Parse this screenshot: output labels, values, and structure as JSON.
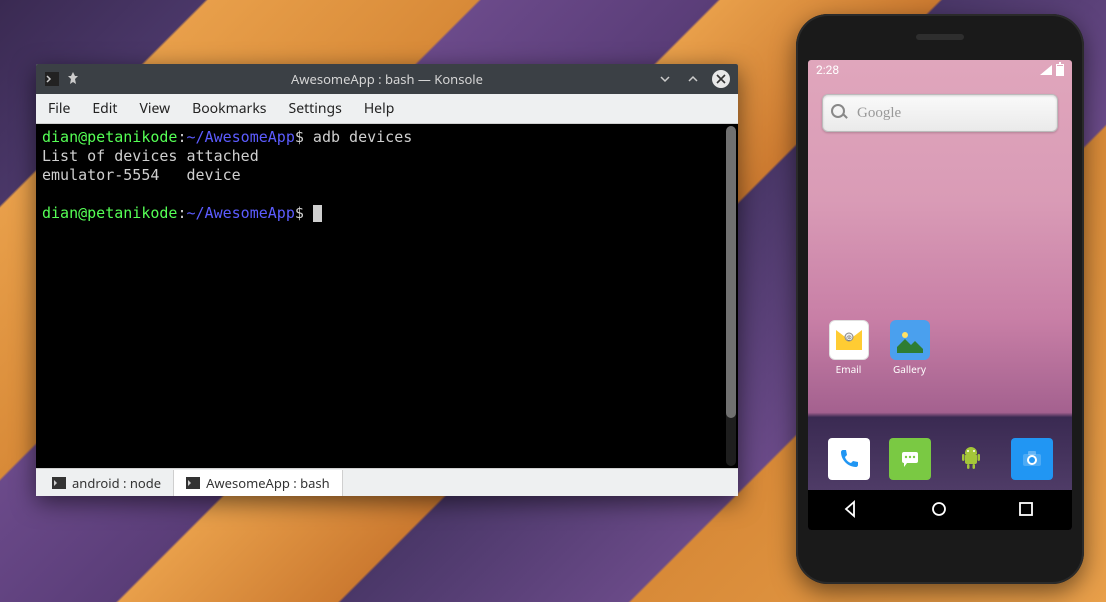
{
  "konsole": {
    "title": "AwesomeApp : bash — Konsole",
    "menus": [
      "File",
      "Edit",
      "View",
      "Bookmarks",
      "Settings",
      "Help"
    ],
    "prompt": {
      "user": "dian",
      "at": "@",
      "host": "petanikode",
      "colon": ":",
      "path": "~/AwesomeApp",
      "dollar": "$"
    },
    "command": " adb devices",
    "output1": "List of devices attached",
    "output2": "emulator-5554   device",
    "tabs": [
      {
        "label": "android : node"
      },
      {
        "label": "AwesomeApp : bash"
      }
    ]
  },
  "phone": {
    "time": "2:28",
    "search_placeholder": "Google",
    "apps_row": [
      {
        "label": "Email"
      },
      {
        "label": "Gallery"
      }
    ],
    "nav": {
      "back": "back",
      "home": "home",
      "recents": "recents"
    }
  }
}
